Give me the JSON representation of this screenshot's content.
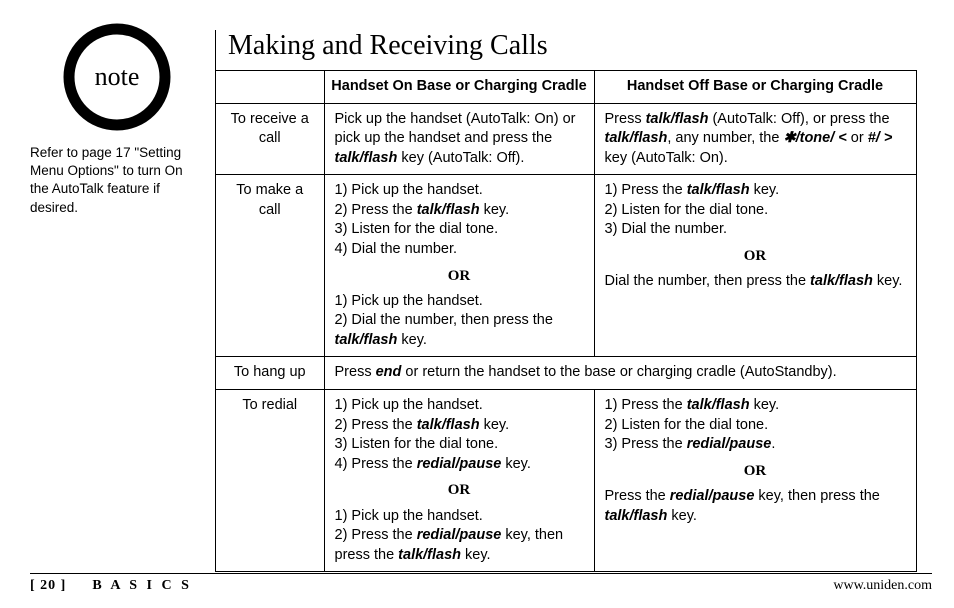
{
  "note": {
    "badge_label": "note",
    "text_html": "Refer to page 17 \"Setting Menu Options\" to turn On the AutoTalk feature if desired."
  },
  "title": "Making and Receiving Calls",
  "table": {
    "head_on": "Handset On Base or Charging Cradle",
    "head_off": "Handset Off Base or Charging Cradle",
    "rows": {
      "receive": {
        "label": "To receive a call",
        "on_html": "Pick up the handset (AutoTalk: On) or pick up the handset and press the <span class='k'>talk/flash</span> key (AutoTalk: Off).",
        "off_html": "Press <span class='k'>talk/flash</span> (AutoTalk: Off), or press the <span class='k'>talk/flash</span>, any number, the <span class='k'>✱/tone/ &lt;</span> or <span class='k'>#/ &gt;</span> key (AutoTalk: On)."
      },
      "make": {
        "label": "To make a call",
        "on1_html": "1) Pick up the handset.<br>2) Press the <span class='k'>talk/flash</span> key.<br>3) Listen for the dial tone.<br>4) Dial the number.",
        "on2_html": "1) Pick up the handset.<br>2) Dial the number, then press the <span class='k'>talk/flash</span> key.",
        "off1_html": "1) Press the <span class='k'>talk/flash</span> key.<br>2) Listen for the dial tone.<br>3) Dial the number.",
        "off2_html": "Dial the number, then press the <span class='k'>talk/flash</span> key."
      },
      "hangup": {
        "label": "To hang up",
        "span_html": "Press <span class='k'>end</span> or return the handset to the base or charging cradle (AutoStandby)."
      },
      "redial": {
        "label": "To redial",
        "on1_html": "1) Pick up the handset.<br>2) Press the <span class='k'>talk/flash</span> key.<br>3) Listen for the dial tone.<br>4) Press the <span class='k'>redial/pause</span> key.",
        "on2_html": "1) Pick up the handset.<br>2) Press the <span class='k'>redial/pause</span> key, then press the <span class='k'>talk/flash</span> key.",
        "off1_html": "1) Press the <span class='k'>talk/flash</span> key.<br>2) Listen for the dial tone.<br>3) Press the <span class='k'>redial/pause</span>.",
        "off2_html": "Press the <span class='k'>redial/pause</span> key, then press the <span class='k'>talk/flash</span> key."
      }
    },
    "or_label": "OR"
  },
  "footer": {
    "page_bracket": "[ 20 ]",
    "section": "B A S I C S",
    "url": "www.uniden.com"
  }
}
